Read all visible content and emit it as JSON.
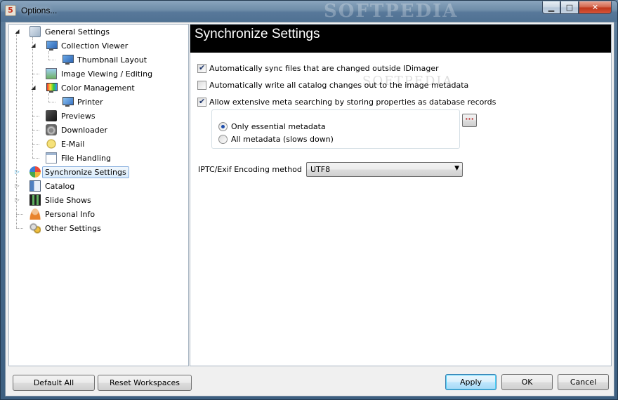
{
  "window": {
    "title": "Options...",
    "app_icon": "5",
    "watermark": "SOFTPEDIA",
    "controls": {
      "minimize": "▁",
      "maximize": "□",
      "close": "✕"
    }
  },
  "tree": {
    "items": [
      {
        "label": "General Settings",
        "icon": "gear-icon",
        "expander": "◢"
      },
      {
        "label": "Collection Viewer",
        "icon": "monitor-icon",
        "expander": "◢"
      },
      {
        "label": "Thumbnail Layout",
        "icon": "monitor-icon"
      },
      {
        "label": "Image Viewing / Editing",
        "icon": "picture-icon"
      },
      {
        "label": "Color Management",
        "icon": "color-monitor-icon",
        "expander": "◢"
      },
      {
        "label": "Printer",
        "icon": "printer-icon"
      },
      {
        "label": "Previews",
        "icon": "previews-icon"
      },
      {
        "label": "Downloader",
        "icon": "camera-icon"
      },
      {
        "label": "E-Mail",
        "icon": "email-icon"
      },
      {
        "label": "File Handling",
        "icon": "file-icon"
      },
      {
        "label": "Synchronize Settings",
        "icon": "sync-icon",
        "expander": "▷",
        "selected": true
      },
      {
        "label": "Catalog",
        "icon": "catalog-icon",
        "expander": "▷"
      },
      {
        "label": "Slide Shows",
        "icon": "film-icon",
        "expander": "▷"
      },
      {
        "label": "Personal Info",
        "icon": "person-icon"
      },
      {
        "label": "Other Settings",
        "icon": "tools-icon"
      }
    ]
  },
  "panel": {
    "title": "Synchronize Settings",
    "options": [
      {
        "label": "Automatically sync files that are changed outside IDimager",
        "checked": true
      },
      {
        "label": "Automatically write all catalog changes out to the image metadata",
        "checked": false
      },
      {
        "label": "Allow extensive meta searching by storing properties as database records",
        "checked": true
      }
    ],
    "metadata_choice": {
      "options": [
        {
          "label": "Only essential metadata",
          "selected": true
        },
        {
          "label": "All metadata (slows down)",
          "selected": false
        }
      ],
      "ellipsis": "···"
    },
    "encoding": {
      "label": "IPTC/Exif Encoding method",
      "value": "UTF8",
      "arrow": "▼"
    },
    "watermark": "SOFTPEDIA"
  },
  "footer": {
    "default_all": "Default All",
    "reset_workspaces": "Reset Workspaces",
    "apply": "Apply",
    "ok": "OK",
    "cancel": "Cancel"
  }
}
